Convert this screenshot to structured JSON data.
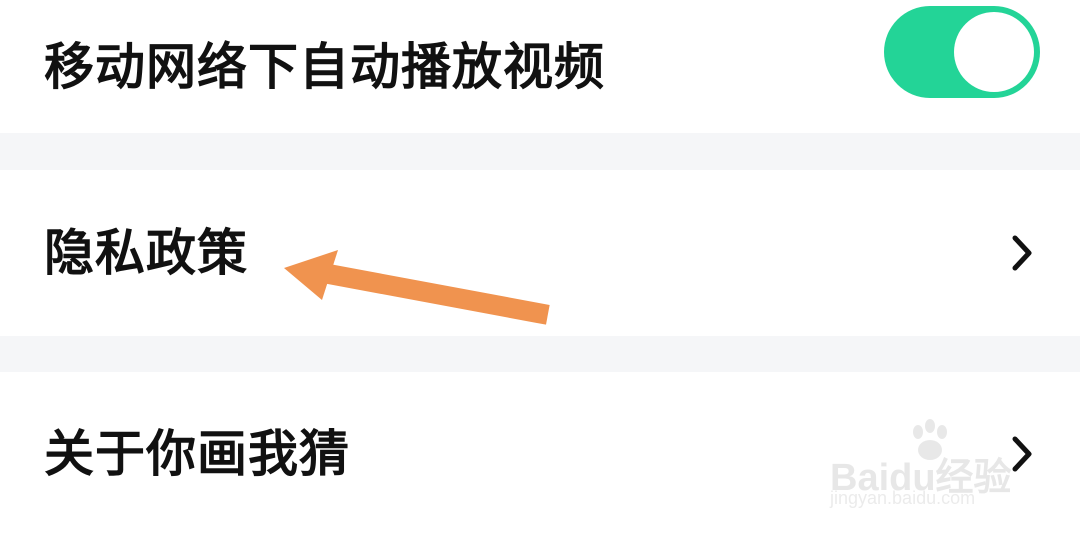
{
  "settings": {
    "autoplay": {
      "label": "移动网络下自动播放视频",
      "enabled": true
    },
    "privacy": {
      "label": "隐私政策"
    },
    "about": {
      "label": "关于你画我猜"
    }
  },
  "watermark": {
    "brand": "Baidu经验",
    "url": "jingyan.baidu.com"
  },
  "colors": {
    "toggle_on": "#23d497",
    "section_divider": "#f5f6f8",
    "annotation_arrow": "#f0934f"
  },
  "icons": {
    "chevron": "chevron-right-icon",
    "annotation": "arrow-left-icon"
  }
}
